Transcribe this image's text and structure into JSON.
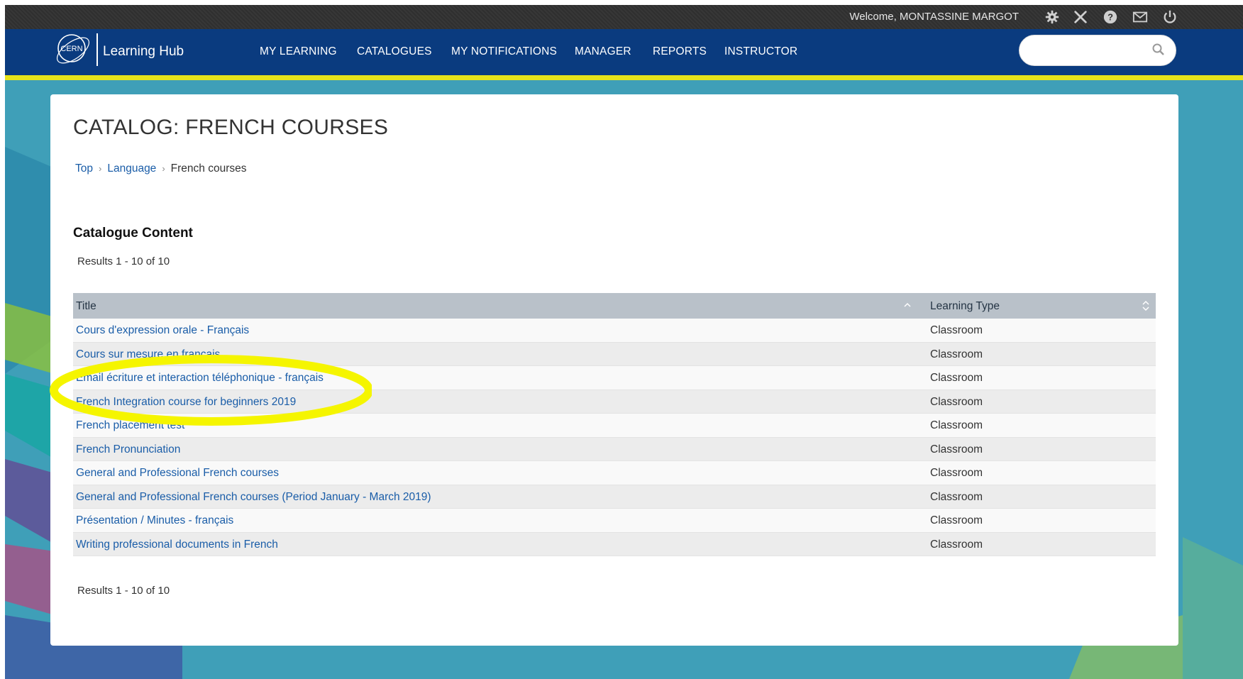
{
  "topbar": {
    "welcome": "Welcome, MONTASSINE MARGOT",
    "icons": [
      "gear-icon",
      "tools-icon",
      "help-icon",
      "mail-icon",
      "power-icon"
    ]
  },
  "brand": {
    "name": "Learning Hub",
    "logo_text": "CERN"
  },
  "nav": {
    "items": [
      "MY LEARNING",
      "CATALOGUES",
      "MY NOTIFICATIONS",
      "MANAGER",
      "REPORTS",
      "INSTRUCTOR"
    ]
  },
  "search": {
    "placeholder": "",
    "value": ""
  },
  "page": {
    "title": "CATALOG: FRENCH COURSES",
    "breadcrumb": [
      "Top",
      "Language",
      "French courses"
    ],
    "section_title": "Catalogue Content",
    "results_top": "Results 1 - 10 of 10",
    "results_bottom": "Results 1 - 10 of 10"
  },
  "table": {
    "headers": [
      "Title",
      "Learning Type"
    ],
    "rows": [
      {
        "title": "Cours d'expression orale - Français",
        "type": "Classroom"
      },
      {
        "title": "Cours sur mesure en français",
        "type": "Classroom"
      },
      {
        "title": "Email écriture et interaction téléphonique - français",
        "type": "Classroom"
      },
      {
        "title": "French Integration course for beginners 2019",
        "type": "Classroom"
      },
      {
        "title": "French placement test",
        "type": "Classroom"
      },
      {
        "title": "French Pronunciation",
        "type": "Classroom"
      },
      {
        "title": "General and Professional French courses",
        "type": "Classroom"
      },
      {
        "title": "General and Professional French courses (Period January - March 2019)",
        "type": "Classroom"
      },
      {
        "title": "Présentation / Minutes - français",
        "type": "Classroom"
      },
      {
        "title": "Writing professional documents in French",
        "type": "Classroom"
      }
    ]
  },
  "colors": {
    "navbar": "#0a3b7f",
    "accent_line": "#e6e21a",
    "link": "#1a5da8",
    "table_header": "#b9c1c9",
    "highlight": "#f5f500"
  }
}
